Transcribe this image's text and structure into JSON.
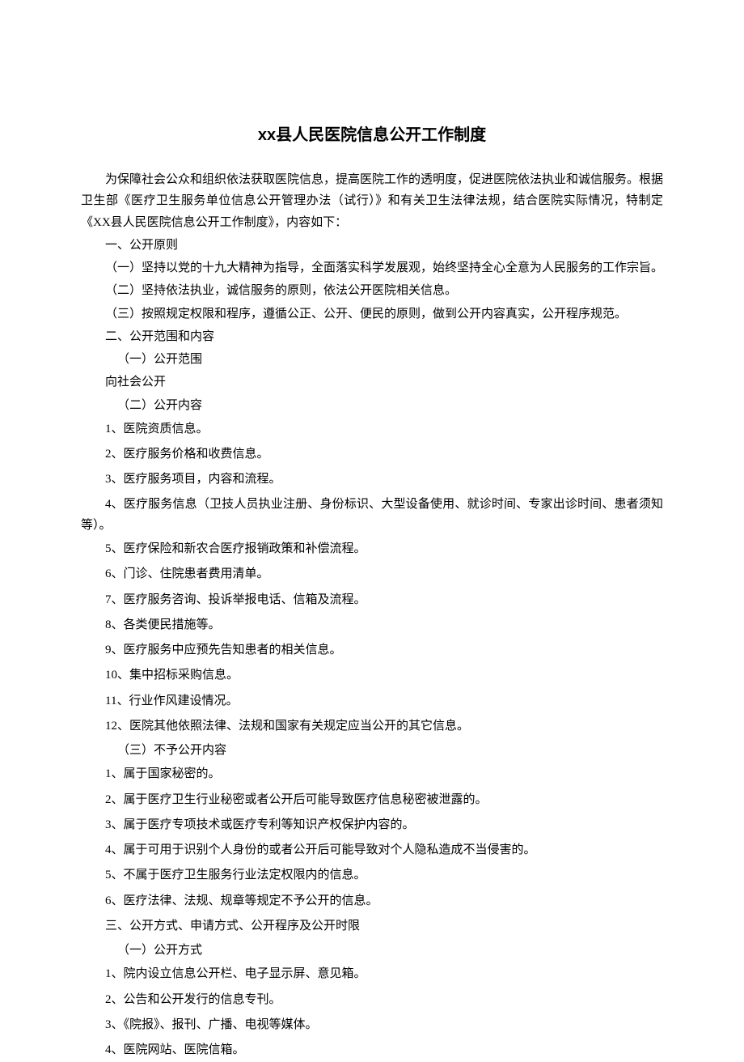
{
  "title": "xx县人民医院信息公开工作制度",
  "intro": "为保障社会公众和组织依法获取医院信息，提高医院工作的透明度，促进医院依法执业和诚信服务。根据卫生部《医疗卫生服务单位信息公开管理办法（试行）》和有关卫生法律法规，结合医院实际情况，特制定《XX县人民医院信息公开工作制度》，内容如下：",
  "section1": {
    "heading": "一、公开原则",
    "items": [
      "（一）坚持以党的十九大精神为指导，全面落实科学发展观，始终坚持全心全意为人民服务的工作宗旨。",
      "（二）坚持依法执业，诚信服务的原则，依法公开医院相关信息。",
      "（三）按照规定权限和程序，遵循公正、公开、便民的原则，做到公开内容真实，公开程序规范。"
    ]
  },
  "section2": {
    "heading": "二、公开范围和内容",
    "sub1_heading": "（一）公开范围",
    "sub1_text": "向社会公开",
    "sub2_heading": "（二）公开内容",
    "sub2_items": [
      "1、医院资质信息。",
      "2、医疗服务价格和收费信息。",
      "3、医疗服务项目，内容和流程。",
      "4、医疗服务信息（卫技人员执业注册、身份标识、大型设备使用、就诊时间、专家出诊时间、患者须知等）。",
      "5、医疗保险和新农合医疗报销政策和补偿流程。",
      "6、门诊、住院患者费用清单。",
      "7、医疗服务咨询、投诉举报电话、信箱及流程。",
      "8、各类便民措施等。",
      "9、医疗服务中应预先告知患者的相关信息。",
      "10、集中招标采购信息。",
      "11、行业作风建设情况。",
      "12、医院其他依照法律、法规和国家有关规定应当公开的其它信息。"
    ],
    "sub3_heading": "（三）不予公开内容",
    "sub3_items": [
      "1、属于国家秘密的。",
      "2、属于医疗卫生行业秘密或者公开后可能导致医疗信息秘密被泄露的。",
      "3、属于医疗专项技术或医疗专利等知识产权保护内容的。",
      "4、属于可用于识别个人身份的或者公开后可能导致对个人隐私造成不当侵害的。",
      "5、不属于医疗卫生服务行业法定权限内的信息。",
      "6、医疗法律、法规、规章等规定不予公开的信息。"
    ]
  },
  "section3": {
    "heading": "三、公开方式、申请方式、公开程序及公开时限",
    "sub1_heading": "（一）公开方式",
    "sub1_items": [
      "1、院内设立信息公开栏、电子显示屏、意见箱。",
      "2、公告和公开发行的信息专刊。",
      "3、《院报》、报刊、广播、电视等媒体。",
      "4、医院网站、医院信箱。"
    ]
  }
}
